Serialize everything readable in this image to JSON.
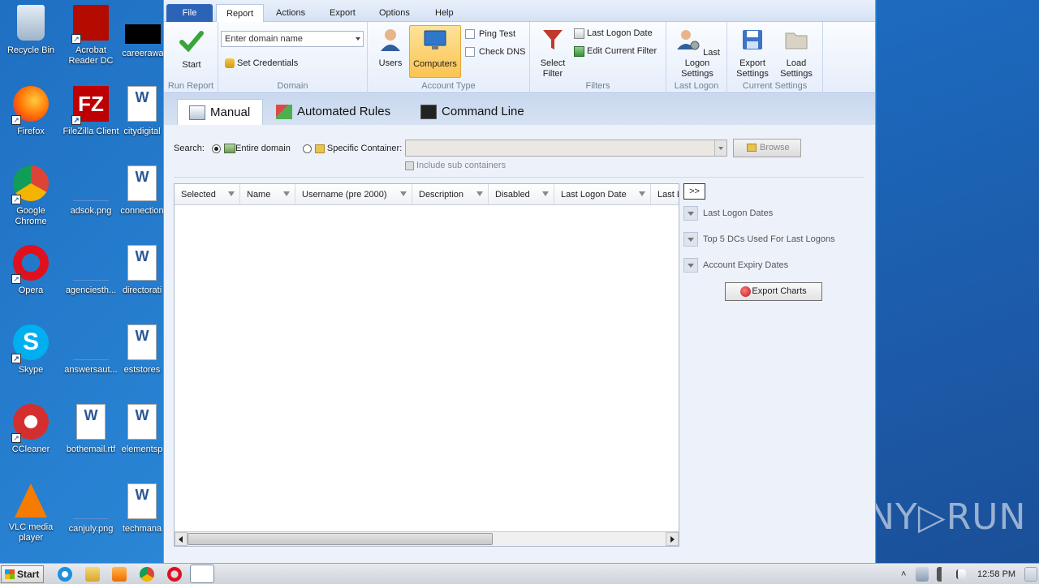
{
  "desktop": {
    "icons_left": [
      {
        "label": "Recycle Bin",
        "icon": "recycle-bin-icon"
      },
      {
        "label": "Firefox",
        "icon": "firefox-icon"
      },
      {
        "label": "Google Chrome",
        "icon": "chrome-icon"
      },
      {
        "label": "Opera",
        "icon": "opera-icon"
      },
      {
        "label": "Skype",
        "icon": "skype-icon"
      },
      {
        "label": "CCleaner",
        "icon": "ccleaner-icon"
      },
      {
        "label": "VLC media player",
        "icon": "vlc-icon"
      }
    ],
    "icons_mid": [
      {
        "label": "Acrobat Reader DC",
        "icon": "acrobat-icon"
      },
      {
        "label": "FileZilla Client",
        "icon": "filezilla-icon"
      },
      {
        "label": "adsok.png",
        "icon": "image-file-icon"
      },
      {
        "label": "agenciesth...",
        "icon": "image-file-icon"
      },
      {
        "label": "answersaut...",
        "icon": "image-file-icon"
      },
      {
        "label": "bothemail.rtf",
        "icon": "word-doc-icon"
      },
      {
        "label": "canjuly.png",
        "icon": "image-file-icon"
      }
    ],
    "icons_right": [
      {
        "label": "careerawa",
        "icon": "black-file-icon"
      },
      {
        "label": "citydigital",
        "icon": "word-doc-icon"
      },
      {
        "label": "connection",
        "icon": "word-doc-icon"
      },
      {
        "label": "directorati",
        "icon": "word-doc-icon"
      },
      {
        "label": "eststores",
        "icon": "word-doc-icon"
      },
      {
        "label": "elementsp",
        "icon": "word-doc-icon"
      },
      {
        "label": "techmana",
        "icon": "word-doc-icon"
      }
    ]
  },
  "app": {
    "menu": [
      "File",
      "Report",
      "Actions",
      "Export",
      "Options",
      "Help"
    ],
    "active_menu": "Report",
    "ribbon": {
      "run_report": {
        "start_label": "Start",
        "group": "Run Report"
      },
      "domain": {
        "placeholder": "Enter domain name",
        "set_credentials": "Set Credentials",
        "group": "Domain"
      },
      "account_type": {
        "users": "Users",
        "computers": "Computers",
        "ping_test": "Ping Test",
        "check_dns": "Check DNS",
        "group": "Account Type"
      },
      "filters": {
        "select_filter": "Select Filter",
        "last_logon_date": "Last Logon Date",
        "edit_current_filter": "Edit Current Filter",
        "group": "Filters"
      },
      "last_logon": {
        "settings": "Last Logon Settings",
        "group": "Last Logon"
      },
      "current_settings": {
        "export": "Export Settings",
        "load": "Load Settings",
        "group": "Current Settings"
      }
    },
    "tabs": [
      "Manual",
      "Automated Rules",
      "Command Line"
    ],
    "search": {
      "label": "Search:",
      "entire_domain": "Entire domain",
      "specific_container": "Specific Container:",
      "browse": "Browse",
      "include_sub": "Include sub containers"
    },
    "grid": {
      "columns": [
        "Selected",
        "Name",
        "Username (pre 2000)",
        "Description",
        "Disabled",
        "Last Logon Date",
        "Last L"
      ]
    },
    "side": {
      "expand": ">>",
      "charts": [
        "Last Logon Dates",
        "Top 5 DCs Used For Last Logons",
        "Account Expiry Dates"
      ],
      "export_charts": "Export Charts"
    }
  },
  "taskbar": {
    "start": "Start",
    "time": "12:58 PM"
  },
  "watermark": "ANY▷RUN"
}
